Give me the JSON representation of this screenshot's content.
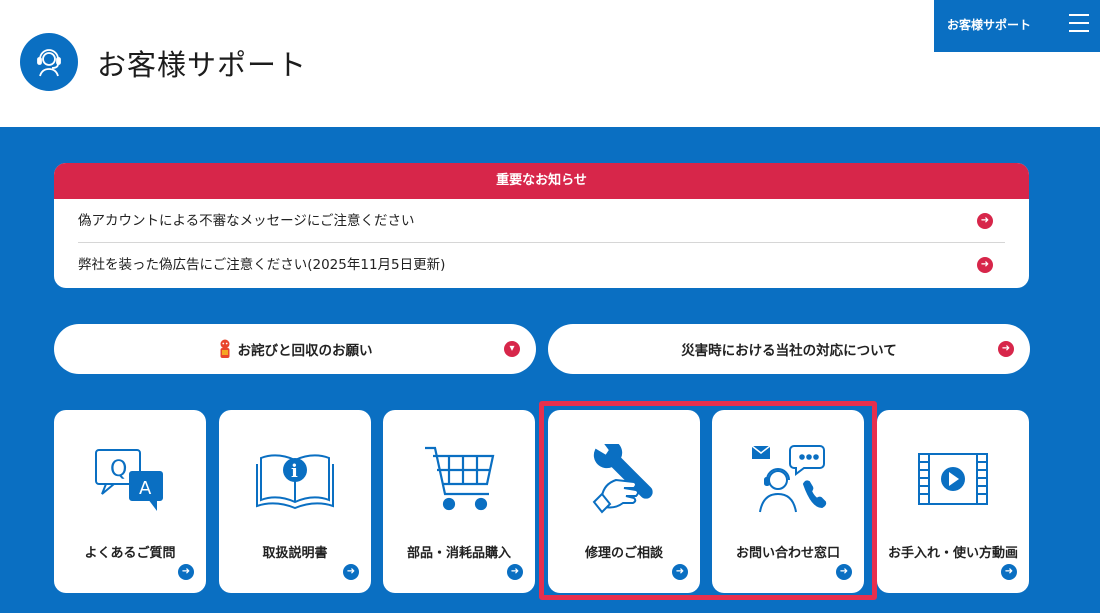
{
  "header": {
    "title": "お客様サポート",
    "menu_label": "お客様サポート",
    "logo_icon": "headset-support-icon",
    "menu_icon": "hamburger-menu-icon"
  },
  "notice": {
    "heading": "重要なお知らせ",
    "items": [
      {
        "text": "偽アカウントによる不審なメッセージにご注意ください"
      },
      {
        "text": "弊社を装った偽広告にご注意ください(2025年11月5日更新)"
      }
    ]
  },
  "pills": [
    {
      "label": "お詫びと回収のお願い",
      "icon": "mascot-icon",
      "arrow": "chevron-down-icon"
    },
    {
      "label": "災害時における当社の対応について",
      "arrow": "arrow-right-icon"
    }
  ],
  "tiles": [
    {
      "label": "よくあるご質問",
      "icon": "qa-bubbles-icon"
    },
    {
      "label": "取扱説明書",
      "icon": "manual-book-icon"
    },
    {
      "label": "部品・消耗品購入",
      "icon": "shopping-cart-icon"
    },
    {
      "label": "修理のご相談",
      "icon": "wrench-hand-icon"
    },
    {
      "label": "お問い合わせ窓口",
      "icon": "operator-contact-icon"
    },
    {
      "label": "お手入れ・使い方動画",
      "icon": "video-film-icon"
    }
  ],
  "colors": {
    "brand_blue": "#0a6fc2",
    "alert_red": "#d7264a",
    "highlight_red": "#e6304e"
  }
}
